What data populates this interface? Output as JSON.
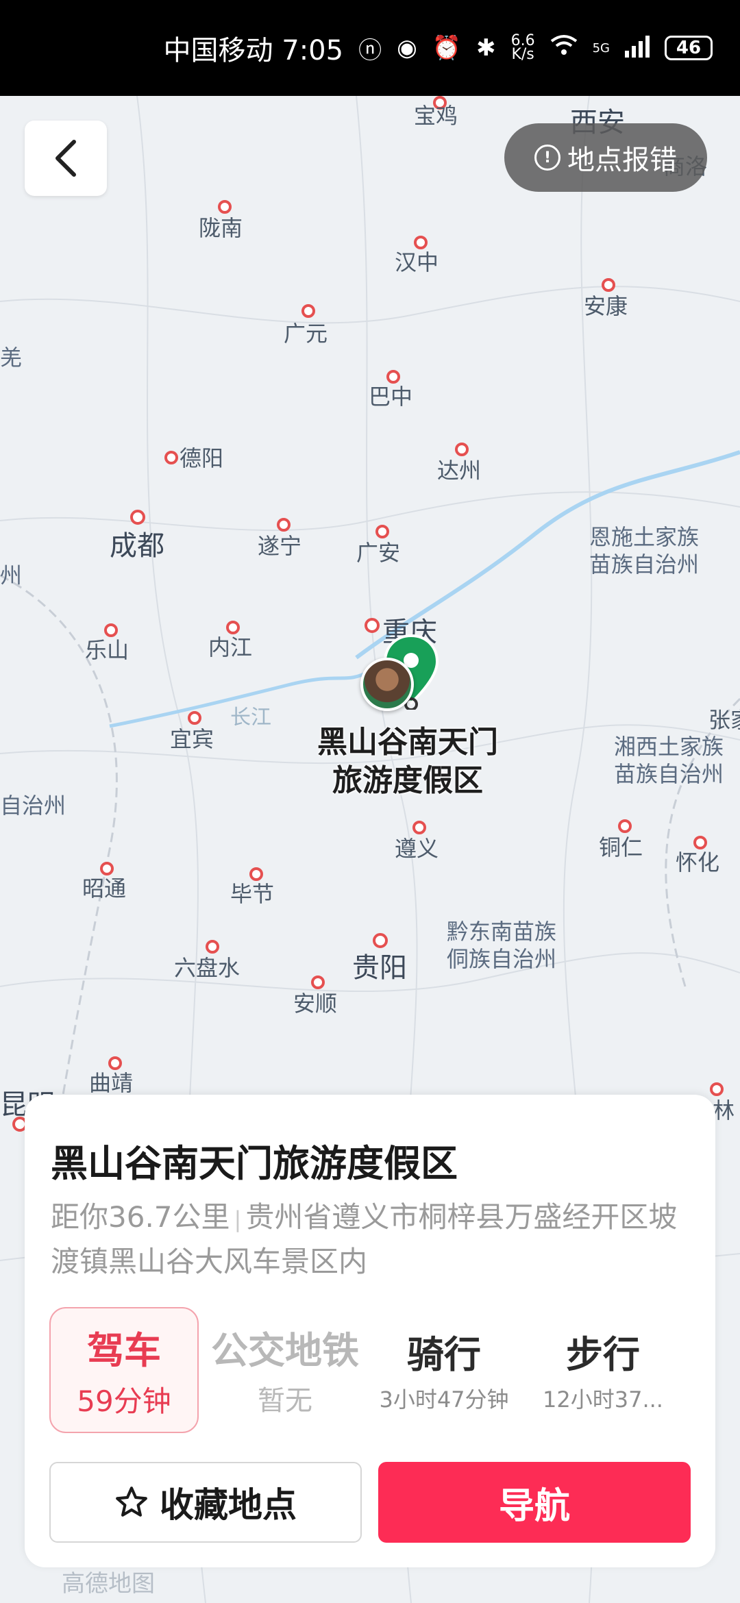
{
  "status_bar": {
    "carrier_time": "中国移动 7:05",
    "net_speed_top": "6.6",
    "net_speed_bottom": "K/s",
    "network": "5G",
    "battery": "46"
  },
  "map": {
    "report_button": "地点报错",
    "cities": [
      {
        "name": "宝鸡"
      },
      {
        "name": "西安"
      },
      {
        "name": "商洛"
      },
      {
        "name": "陇南"
      },
      {
        "name": "汉中"
      },
      {
        "name": "安康"
      },
      {
        "name": "广元"
      },
      {
        "name": "巴中"
      },
      {
        "name": "德阳"
      },
      {
        "name": "达州"
      },
      {
        "name": "成都"
      },
      {
        "name": "遂宁"
      },
      {
        "name": "广安"
      },
      {
        "name": "乐山"
      },
      {
        "name": "内江"
      },
      {
        "name": "重庆"
      },
      {
        "name": "宜宾"
      },
      {
        "name": "遵义"
      },
      {
        "name": "铜仁"
      },
      {
        "name": "怀化"
      },
      {
        "name": "昭通"
      },
      {
        "name": "毕节"
      },
      {
        "name": "贵阳"
      },
      {
        "name": "六盘水"
      },
      {
        "name": "安顺"
      },
      {
        "name": "曲靖"
      },
      {
        "name": "昆明"
      },
      {
        "name": "张家"
      },
      {
        "name": "林"
      }
    ],
    "regions": [
      {
        "line1": "恩施土家族",
        "line2": "苗族自治州"
      },
      {
        "line1": "湘西土家族",
        "line2": "苗族自治州"
      },
      {
        "line1": "黔东南苗族",
        "line2": "侗族自治州"
      },
      {
        "line1": "自治州"
      },
      {
        "line1": "羌"
      },
      {
        "line1": "州"
      }
    ],
    "river": "长江",
    "pin_label_line1": "黑山谷南天门",
    "pin_label_line2": "旅游度假区",
    "watermark": "高德地图"
  },
  "card": {
    "title": "黑山谷南天门旅游度假区",
    "distance": "距你36.7公里",
    "separator": "|",
    "address": "贵州省遵义市桐梓县万盛经开区坡渡镇黑山谷大风车景区内",
    "modes": [
      {
        "name": "驾车",
        "time": "59分钟"
      },
      {
        "name": "公交地铁",
        "time": "暂无"
      },
      {
        "name": "骑行",
        "time": "3小时47分钟"
      },
      {
        "name": "步行",
        "time": "12小时37..."
      }
    ],
    "favorite_label": "收藏地点",
    "navigate_label": "导航"
  },
  "colors": {
    "accent": "#fd2c55",
    "pin": "#18a058",
    "city_dot": "#e55050"
  }
}
